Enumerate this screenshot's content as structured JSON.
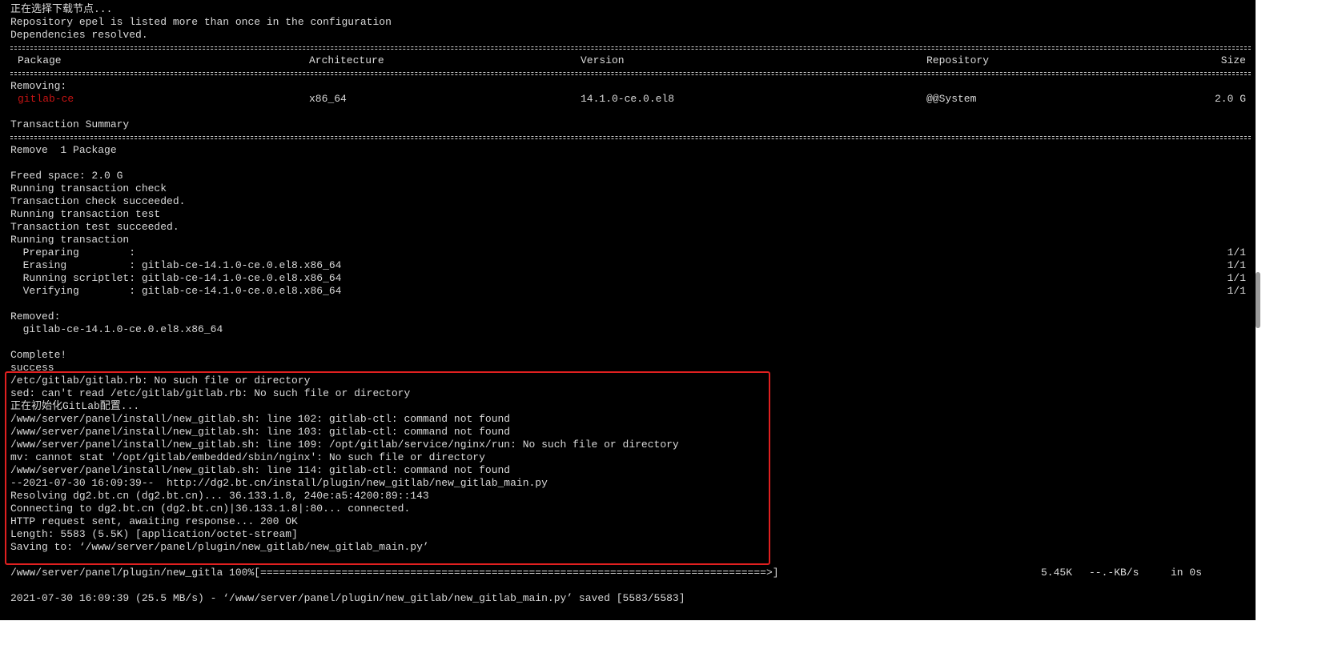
{
  "terminal": {
    "line_selecting_node": "正在选择下载节点...",
    "line_repo_warning": "Repository epel is listed more than once in the configuration",
    "line_deps_resolved": "Dependencies resolved.",
    "table": {
      "header": {
        "package": "Package",
        "architecture": "Architecture",
        "version": "Version",
        "repository": "Repository",
        "size": "Size"
      },
      "section_label": "Removing:",
      "row": {
        "package": "gitlab-ce",
        "architecture": "x86_64",
        "version": "14.1.0-ce.0.el8",
        "repository": "@@System",
        "size": "2.0 G"
      }
    },
    "transaction_summary": "Transaction Summary",
    "remove_count": "Remove  1 Package",
    "freed_space": "Freed space: 2.0 G",
    "running_check": "Running transaction check",
    "check_succeeded": "Transaction check succeeded.",
    "running_test": "Running transaction test",
    "test_succeeded": "Transaction test succeeded.",
    "running_transaction": "Running transaction",
    "steps": [
      {
        "text": "  Preparing        :",
        "count": "1/1"
      },
      {
        "text": "  Erasing          : gitlab-ce-14.1.0-ce.0.el8.x86_64",
        "count": "1/1"
      },
      {
        "text": "  Running scriptlet: gitlab-ce-14.1.0-ce.0.el8.x86_64",
        "count": "1/1"
      },
      {
        "text": "  Verifying        : gitlab-ce-14.1.0-ce.0.el8.x86_64",
        "count": "1/1"
      }
    ],
    "removed_label": "Removed:",
    "removed_pkg": "  gitlab-ce-14.1.0-ce.0.el8.x86_64",
    "complete": "Complete!",
    "highlighted_lines": [
      "success",
      "/etc/gitlab/gitlab.rb: No such file or directory",
      "sed: can't read /etc/gitlab/gitlab.rb: No such file or directory",
      "正在初始化GitLab配置...",
      "/www/server/panel/install/new_gitlab.sh: line 102: gitlab-ctl: command not found",
      "/www/server/panel/install/new_gitlab.sh: line 103: gitlab-ctl: command not found",
      "/www/server/panel/install/new_gitlab.sh: line 109: /opt/gitlab/service/nginx/run: No such file or directory",
      "mv: cannot stat '/opt/gitlab/embedded/sbin/nginx': No such file or directory",
      "/www/server/panel/install/new_gitlab.sh: line 114: gitlab-ctl: command not found",
      "--2021-07-30 16:09:39--  http://dg2.bt.cn/install/plugin/new_gitlab/new_gitlab_main.py",
      "Resolving dg2.bt.cn (dg2.bt.cn)... 36.133.1.8, 240e:a5:4200:89::143",
      "Connecting to dg2.bt.cn (dg2.bt.cn)|36.133.1.8|:80... connected.",
      "HTTP request sent, awaiting response... 200 OK",
      "Length: 5583 (5.5K) [application/octet-stream]",
      "Saving to: ‘/www/server/panel/plugin/new_gitlab/new_gitlab_main.py’"
    ],
    "progress": {
      "file": "/www/server/panel/plugin/new_gitla 100%[=================================================================================>]",
      "size": "5.45K",
      "rate": "--.-KB/s",
      "time": "in 0s"
    },
    "saved_line": "2021-07-30 16:09:39 (25.5 MB/s) - ‘/www/server/panel/plugin/new_gitlab/new_gitlab_main.py’ saved [5583/5583]"
  },
  "colors": {
    "background": "#000000",
    "text": "#d9d9d9",
    "package_highlight": "#c81414",
    "annotation_box": "#e02020"
  }
}
